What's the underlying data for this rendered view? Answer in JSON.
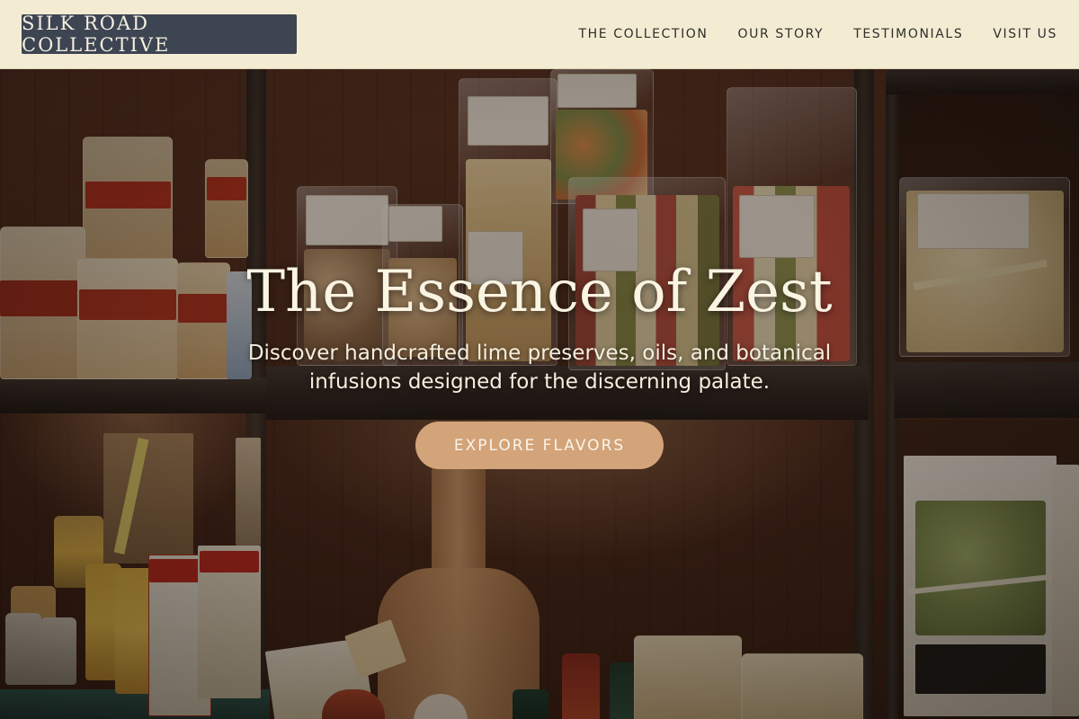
{
  "brand": {
    "name": "SILK ROAD COLLECTIVE"
  },
  "nav": {
    "links": [
      {
        "label": "THE COLLECTION"
      },
      {
        "label": "OUR STORY"
      },
      {
        "label": "TESTIMONIALS"
      },
      {
        "label": "VISIT US"
      }
    ]
  },
  "hero": {
    "title": "The Essence of Zest",
    "subtitle": "Discover handcrafted lime preserves, oils, and botanical infusions designed for the discerning palate.",
    "cta_label": "EXPLORE FLAVORS"
  },
  "colors": {
    "nav_background": "#f3ecd3",
    "logo_background": "#3d4452",
    "logo_text": "#f4efe0",
    "cta_background": "#d3a37a",
    "hero_text": "#faf4e2"
  }
}
